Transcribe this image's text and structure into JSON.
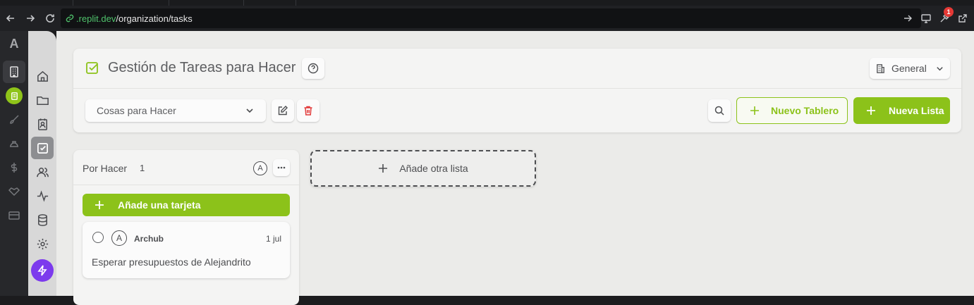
{
  "browser": {
    "url_host": ".replit.dev",
    "url_path": "/organization/tasks",
    "extension_badge": "1"
  },
  "app": {
    "brand_letter": "A",
    "accent_color": "#8cc21a",
    "danger_color": "#e23a3a",
    "bolt_color": "#7c3aed"
  },
  "rail_dark": {
    "icons": [
      "building-icon",
      "org-avatar-icon",
      "brush-icon",
      "helmet-icon",
      "dollar-icon",
      "handshake-icon",
      "card-icon"
    ]
  },
  "rail_light": {
    "icons": [
      "home-icon",
      "folder-icon",
      "contact-icon",
      "tasks-icon",
      "users-icon",
      "activity-icon",
      "database-icon",
      "settings-icon"
    ],
    "active": "tasks-icon"
  },
  "header": {
    "title": "Gestión de Tareas para Hacer",
    "scope_selector": "General"
  },
  "toolbar": {
    "board_selected": "Cosas para Hacer",
    "new_board_label": "Nuevo Tablero",
    "new_list_label": "Nueva Lista"
  },
  "lists": [
    {
      "name": "Por Hacer",
      "count": "1",
      "avatar_initial": "A",
      "add_card_label": "Añade una tarjeta",
      "cards": [
        {
          "avatar_initial": "A",
          "owner": "Archub",
          "date": "1 jul",
          "title": "Esperar presupuestos de Alejandrito"
        }
      ]
    }
  ],
  "add_list_label": "Añade otra lista"
}
